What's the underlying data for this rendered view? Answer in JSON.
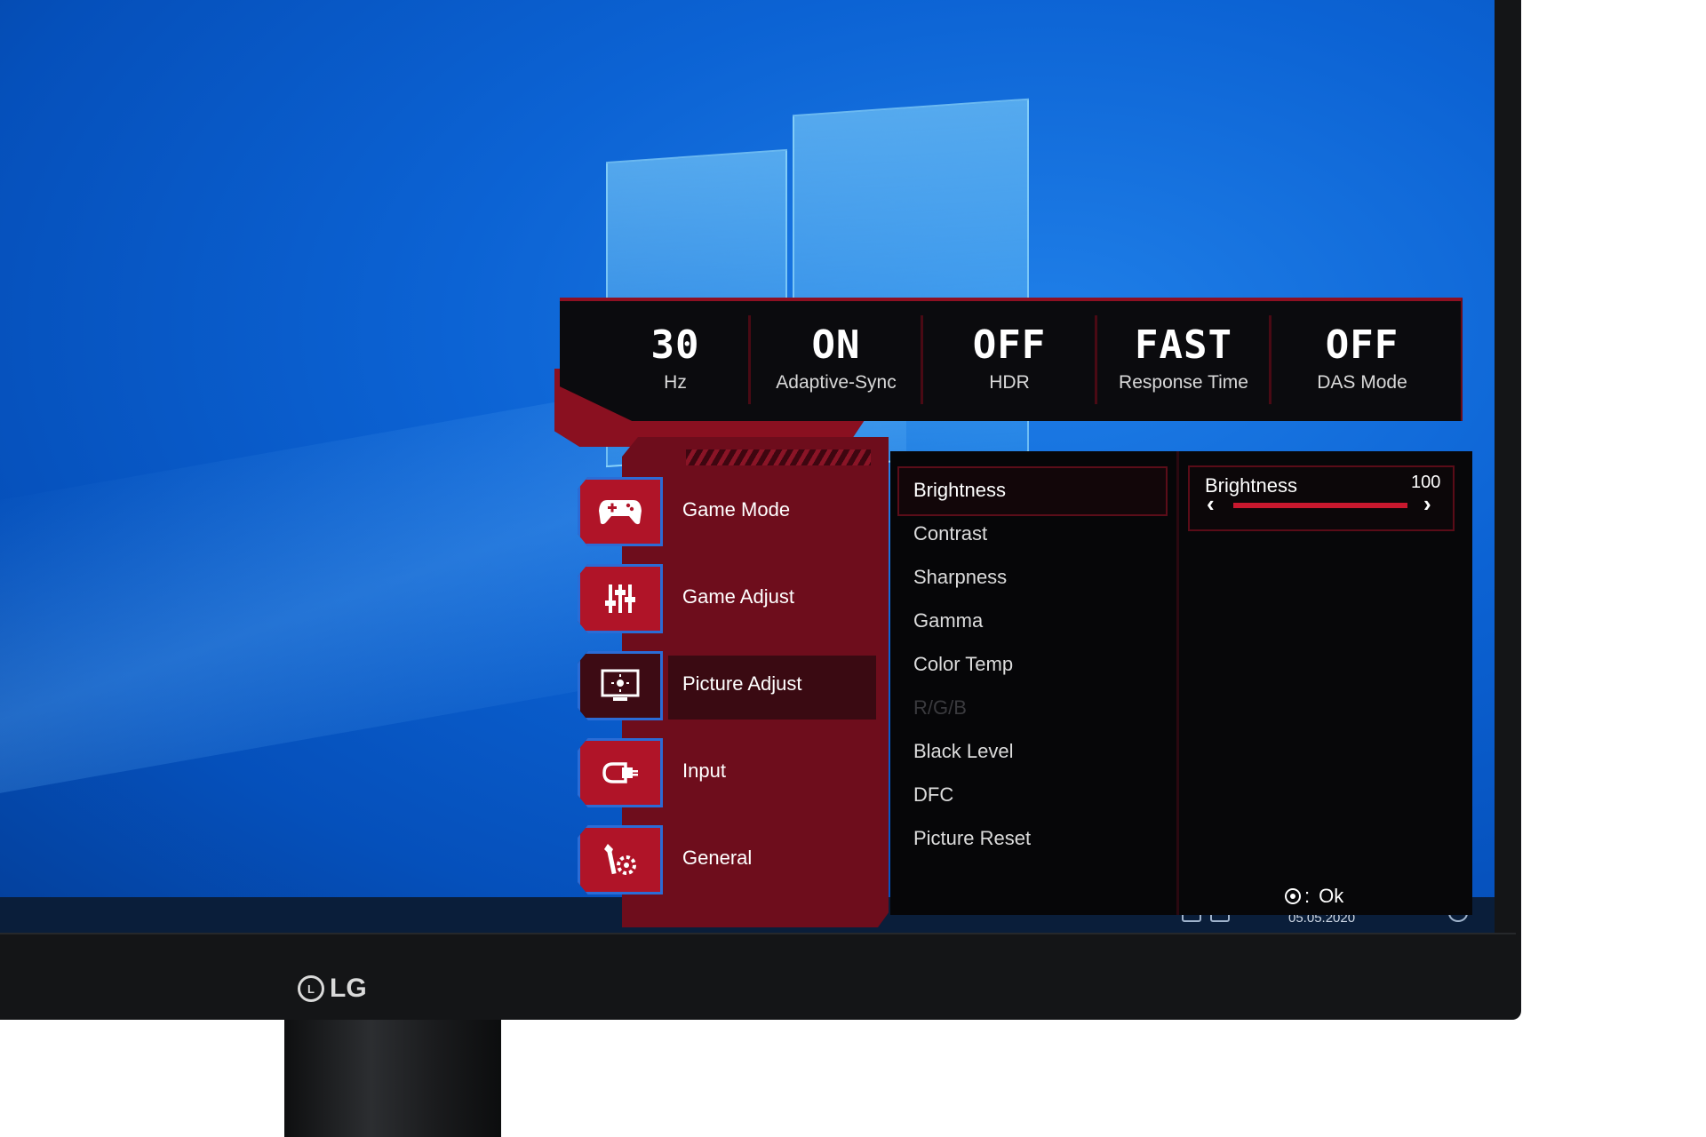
{
  "monitor": {
    "brand": "LG"
  },
  "status_bar": {
    "items": [
      {
        "value": "30",
        "label": "Hz"
      },
      {
        "value": "ON",
        "label": "Adaptive-Sync"
      },
      {
        "value": "OFF",
        "label": "HDR"
      },
      {
        "value": "FAST",
        "label": "Response Time"
      },
      {
        "value": "OFF",
        "label": "DAS Mode"
      }
    ]
  },
  "nav": {
    "items": [
      {
        "label": "Game Mode",
        "icon": "gamepad-icon"
      },
      {
        "label": "Game Adjust",
        "icon": "sliders-icon"
      },
      {
        "label": "Picture Adjust",
        "icon": "picture-icon",
        "active": true
      },
      {
        "label": "Input",
        "icon": "input-icon"
      },
      {
        "label": "General",
        "icon": "wrench-gear-icon"
      }
    ]
  },
  "submenu": {
    "items": [
      {
        "label": "Brightness",
        "selected": true
      },
      {
        "label": "Contrast"
      },
      {
        "label": "Sharpness"
      },
      {
        "label": "Gamma"
      },
      {
        "label": "Color Temp"
      },
      {
        "label": "R/G/B",
        "disabled": true
      },
      {
        "label": "Black Level"
      },
      {
        "label": "DFC"
      },
      {
        "label": "Picture Reset"
      }
    ]
  },
  "detail": {
    "title": "Brightness",
    "value": "100",
    "level": 1.0,
    "left_arrow": "‹",
    "right_arrow": "›"
  },
  "footer": {
    "ok_label": "Ok",
    "ok_separator": ":"
  },
  "taskbar": {
    "date": "05.05.2020"
  },
  "colors": {
    "accent": "#b01428",
    "dark_red": "#6e0d1c",
    "panel": "#060608",
    "desktop": "#0c63d4"
  }
}
